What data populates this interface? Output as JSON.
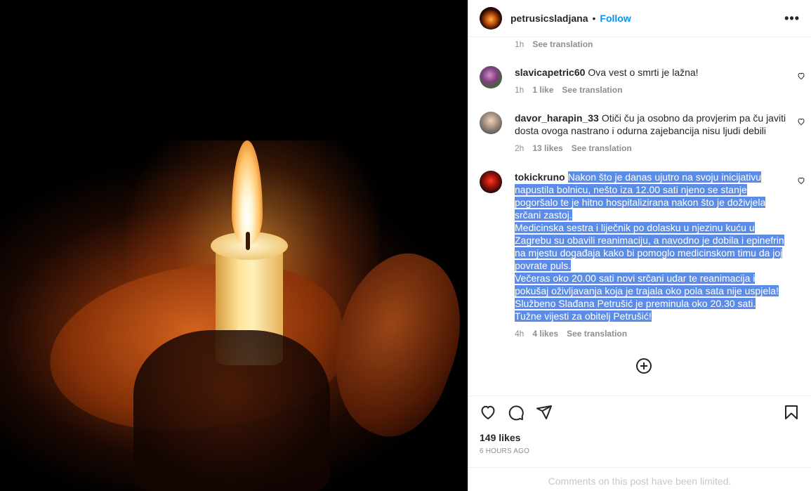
{
  "post": {
    "owner": "petrusicsladjana",
    "dot": "•",
    "follow_label": "Follow",
    "more_label": "•••",
    "likes": "149 likes",
    "time_ago": "6 HOURS AGO",
    "limited_notice": "Comments on this post have been limited."
  },
  "comments": [
    {
      "username": "",
      "text": "",
      "time": "1h",
      "likes": "",
      "translate": "See translation"
    },
    {
      "username": "slavicapetric60",
      "text": "Ova vest o smrti je lažna!",
      "time": "1h",
      "likes": "1 like",
      "translate": "See translation"
    },
    {
      "username": "davor_harapin_33",
      "text": "Otiči ču ja osobno da provjerim pa ču javiti dosta ovoga nastrano i odurna zajebancija nisu ljudi debili",
      "time": "2h",
      "likes": "13 likes",
      "translate": "See translation"
    },
    {
      "username": "tokickruno",
      "text": "Nakon što je danas ujutro na svoju inicijativu napustila bolnicu, nešto iza 12.00 sati njeno se stanje pogoršalo te je hitno hospitalizirana nakon što je doživjela srčani zastoj.\nMedicinska sestra i liječnik po dolasku u njezinu kuću u Zagrebu su obavili reanimaciju, a navodno je dobila i epinefrin na mjestu događaja kako bi pomoglo medicinskom timu da joj povrate puls.\nVečeras oko 20.00 sati novi srčani udar te reanimacija i pokušaj oživljavanja koja je trajala oko pola sata nije uspjela! Službeno Slađana Petrušić je preminula oko 20.30 sati.\nTužne vijesti za obitelj Petrušić!",
      "time": "4h",
      "likes": "4 likes",
      "translate": "See translation"
    }
  ],
  "icons": {
    "like": "heart-icon",
    "comment": "comment-icon",
    "share": "share-icon",
    "save": "bookmark-icon",
    "load_more": "plus-circle-icon"
  }
}
